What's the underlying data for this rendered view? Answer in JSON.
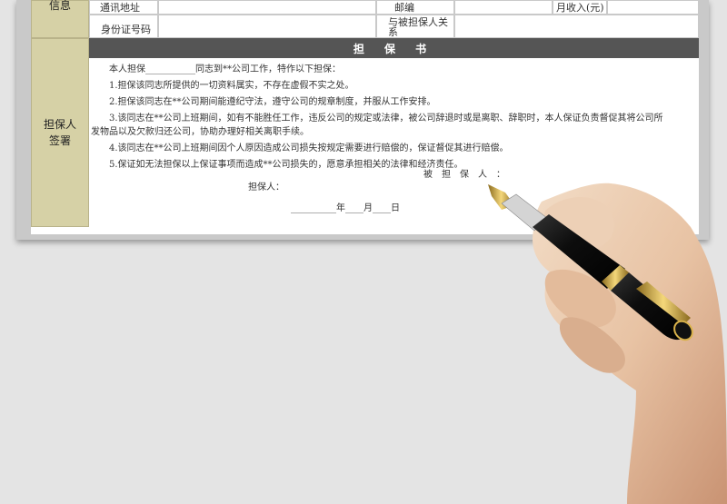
{
  "top_rows": {
    "section_label": "信息",
    "row1": {
      "address_label": "通讯地址",
      "postcode_label": "邮编",
      "income_label": "月收入(元)"
    },
    "row2": {
      "id_label": "身份证号码",
      "relation_label_line1": "与被担保人关",
      "relation_label_line2": "系"
    }
  },
  "guarantor_label": "担保人签署",
  "letter": {
    "heading": "担 保 书",
    "intro": "本人担保___________同志到**公司工作，特作以下担保：",
    "items": [
      "1.担保该同志所提供的一切资料属实，不存在虚假不实之处。",
      "2.担保该同志在**公司期间能遵纪守法，遵守公司的规章制度，并服从工作安排。",
      "3.该同志在**公司上班期间，如有不能胜任工作，违反公司的规定或法律，被公司辞退时或是离职、辞职时，本人保证负责督促其将公司所",
      "发物品以及欠款归还公司，协助办理好相关离职手续。",
      "4.该同志在**公司上班期间因个人原因造成公司损失按规定需要进行赔偿的，保证督促其进行赔偿。",
      "5.保证如无法担保以上保证事项而造成**公司损失的，愿意承担相关的法律和经济责任。"
    ],
    "guaranteed_label": "被　担　保　人　：",
    "guarantor_label": "担保人：",
    "date_line": "__________年____月____日"
  },
  "colors": {
    "banner": "#555555",
    "side": "#d6d1a6"
  }
}
